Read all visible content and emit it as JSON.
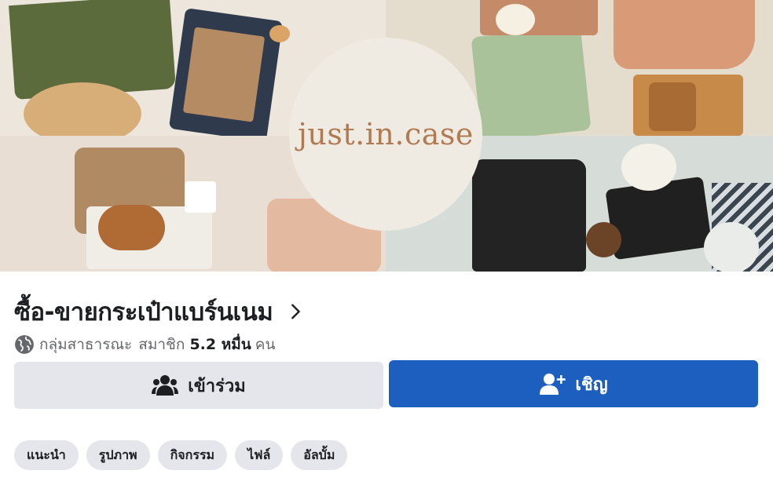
{
  "cover": {
    "logo_text": "just.in.case"
  },
  "group": {
    "title": "ซื้อ-ขายกระเป๋าแบร์นเนม",
    "privacy": "กลุ่มสาธารณะ",
    "members_label": "สมาชิก",
    "members_count": "5.2 หมื่น",
    "members_unit": "คน"
  },
  "actions": {
    "join_label": "เข้าร่วม",
    "invite_label": "เชิญ"
  },
  "tabs": [
    {
      "label": "แนะนำ"
    },
    {
      "label": "รูปภาพ"
    },
    {
      "label": "กิจกรรม"
    },
    {
      "label": "ไฟล์"
    },
    {
      "label": "อัลบั้ม"
    }
  ],
  "icons": {
    "globe": "globe-icon",
    "chevron": "chevron-right-icon",
    "join": "group-people-icon",
    "invite": "add-person-icon"
  },
  "colors": {
    "primary": "#1d5fbf",
    "secondary_button": "#e4e6eb",
    "logo": "#b07a52"
  }
}
